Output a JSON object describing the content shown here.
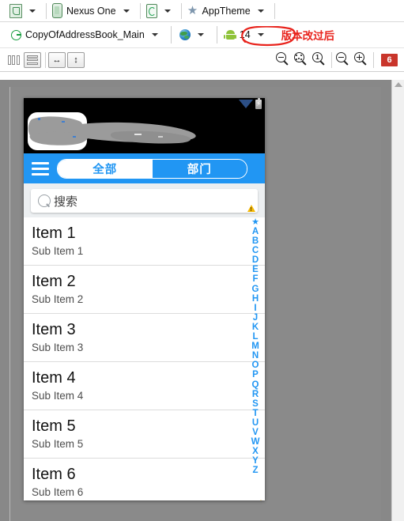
{
  "toolbar_row1": {
    "config_selector": {
      "icon": "layout-document-icon",
      "label": ""
    },
    "device_selector": {
      "icon": "device-phone-icon",
      "label": "Nexus One"
    },
    "orientation_selector": {
      "icon": "rotate-screen-icon",
      "label": ""
    },
    "theme_selector": {
      "icon": "star-icon",
      "label": "AppTheme"
    }
  },
  "toolbar_row2": {
    "activity_selector": {
      "icon": "green-circle-icon",
      "label": "CopyOfAddressBook_Main"
    },
    "locale_selector": {
      "icon": "globe-icon",
      "label": ""
    },
    "api_selector": {
      "icon": "android-robot-icon",
      "label": "14"
    },
    "annotation": "版本改过后"
  },
  "toolbar_row3": {
    "split_vertical": "split-columns-icon",
    "split_horizontal": "split-rows-icon",
    "fit_width": "fit-width-icon",
    "fit_height": "fit-height-icon",
    "zoom_out_fit": "zoom-out-icon",
    "zoom_fit": "zoom-fit-icon",
    "zoom_actual": "zoom-100-icon",
    "zoom_minus": "zoom-minus-icon",
    "zoom_plus": "zoom-plus-icon",
    "error_count": "6"
  },
  "device_preview": {
    "statusbar": {
      "signal_icon": "signal-triangle-icon",
      "battery_icon": "battery-charging-icon"
    },
    "header_note": "",
    "actionbar": {
      "menu_icon": "hamburger-menu-icon",
      "tabs": [
        {
          "label": "全部",
          "selected": true
        },
        {
          "label": "部门",
          "selected": false
        }
      ]
    },
    "search": {
      "icon": "search-icon",
      "placeholder": "搜索",
      "warning_icon": "warning-triangle-icon"
    },
    "list_items": [
      {
        "title": "Item 1",
        "subtitle": "Sub Item 1"
      },
      {
        "title": "Item 2",
        "subtitle": "Sub Item 2"
      },
      {
        "title": "Item 3",
        "subtitle": "Sub Item 3"
      },
      {
        "title": "Item 4",
        "subtitle": "Sub Item 4"
      },
      {
        "title": "Item 5",
        "subtitle": "Sub Item 5"
      },
      {
        "title": "Item 6",
        "subtitle": "Sub Item 6"
      }
    ],
    "index_letters": [
      "★",
      "A",
      "B",
      "C",
      "D",
      "E",
      "F",
      "G",
      "H",
      "I",
      "J",
      "K",
      "L",
      "M",
      "N",
      "O",
      "P",
      "Q",
      "R",
      "S",
      "T",
      "U",
      "V",
      "W",
      "X",
      "Y",
      "Z"
    ],
    "index_warning_icon": "warning-triangle-icon"
  },
  "colors": {
    "accent_blue": "#2196f3",
    "annotation_red": "#e8231c",
    "error_badge": "#c9352b",
    "canvas_gray": "#888888",
    "warning_yellow": "#f2b705"
  }
}
